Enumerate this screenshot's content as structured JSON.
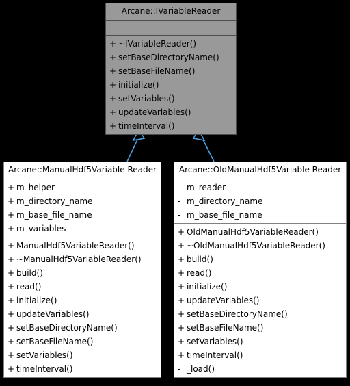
{
  "diagram": {
    "kind": "uml-class-inheritance-diagram",
    "background_color": "#000000",
    "edge_color": "#4a9fe0",
    "interface_fill": "#999999",
    "interface_border": "#4d4d4d",
    "class_fill": "#ffffff",
    "class_border": "#808080"
  },
  "classes": [
    {
      "id": "ivariablereader",
      "title": "Arcane::IVariableReader",
      "style": "interface-style",
      "attributes": [],
      "methods": [
        {
          "visibility": "+",
          "name": "~IVariableReader()"
        },
        {
          "visibility": "+",
          "name": "setBaseDirectoryName()"
        },
        {
          "visibility": "+",
          "name": "setBaseFileName()"
        },
        {
          "visibility": "+",
          "name": "initialize()"
        },
        {
          "visibility": "+",
          "name": "setVariables()"
        },
        {
          "visibility": "+",
          "name": "updateVariables()"
        },
        {
          "visibility": "+",
          "name": "timeInterval()"
        }
      ]
    },
    {
      "id": "manualhdf5variablereader",
      "title": "Arcane::ManualHdf5Variable Reader",
      "style": "concrete-style",
      "attributes": [
        {
          "visibility": "+",
          "name": "m_helper"
        },
        {
          "visibility": "+",
          "name": "m_directory_name"
        },
        {
          "visibility": "+",
          "name": "m_base_file_name"
        },
        {
          "visibility": "+",
          "name": "m_variables"
        }
      ],
      "methods": [
        {
          "visibility": "+",
          "name": "ManualHdf5VariableReader()"
        },
        {
          "visibility": "+",
          "name": "~ManualHdf5VariableReader()"
        },
        {
          "visibility": "+",
          "name": "build()"
        },
        {
          "visibility": "+",
          "name": "read()"
        },
        {
          "visibility": "+",
          "name": "initialize()"
        },
        {
          "visibility": "+",
          "name": "updateVariables()"
        },
        {
          "visibility": "+",
          "name": "setBaseDirectoryName()"
        },
        {
          "visibility": "+",
          "name": "setBaseFileName()"
        },
        {
          "visibility": "+",
          "name": "setVariables()"
        },
        {
          "visibility": "+",
          "name": "timeInterval()"
        }
      ]
    },
    {
      "id": "oldmanualhdf5variablereader",
      "title": "Arcane::OldManualHdf5Variable Reader",
      "style": "concrete-style",
      "attributes": [
        {
          "visibility": "-",
          "name": "m_reader"
        },
        {
          "visibility": "-",
          "name": "m_directory_name"
        },
        {
          "visibility": "-",
          "name": "m_base_file_name"
        }
      ],
      "methods": [
        {
          "visibility": "+",
          "name": "OldManualHdf5VariableReader()"
        },
        {
          "visibility": "+",
          "name": "~OldManualHdf5VariableReader()"
        },
        {
          "visibility": "+",
          "name": "build()"
        },
        {
          "visibility": "+",
          "name": "read()"
        },
        {
          "visibility": "+",
          "name": "initialize()"
        },
        {
          "visibility": "+",
          "name": "updateVariables()"
        },
        {
          "visibility": "+",
          "name": "setBaseDirectoryName()"
        },
        {
          "visibility": "+",
          "name": "setBaseFileName()"
        },
        {
          "visibility": "+",
          "name": "setVariables()"
        },
        {
          "visibility": "+",
          "name": "timeInterval()"
        },
        {
          "visibility": "-",
          "name": "_load()"
        }
      ]
    }
  ],
  "edges": [
    {
      "from": "manualhdf5variablereader",
      "to": "ivariablereader",
      "type": "inheritance"
    },
    {
      "from": "oldmanualhdf5variablereader",
      "to": "ivariablereader",
      "type": "inheritance"
    }
  ]
}
